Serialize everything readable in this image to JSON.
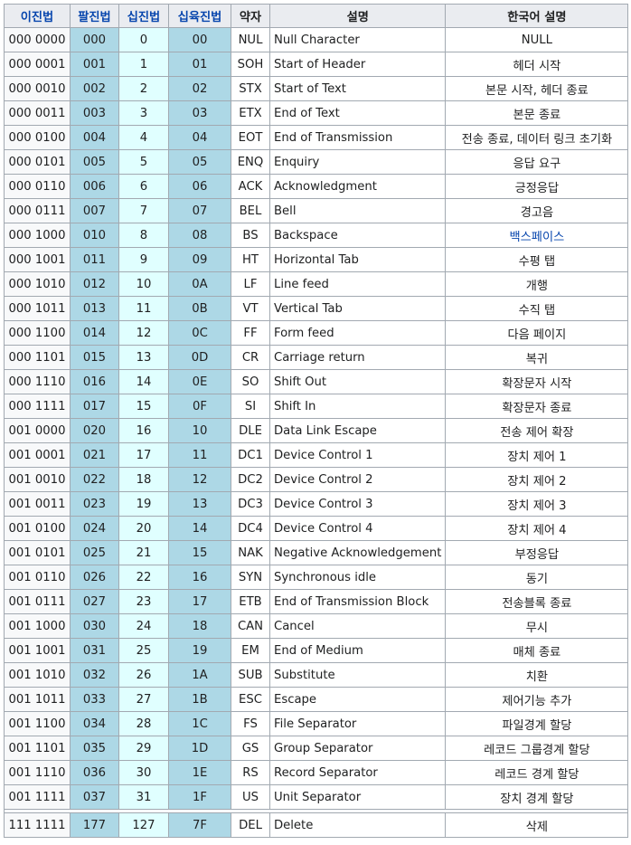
{
  "headers": {
    "bin": "이진법",
    "oct": "팔진법",
    "dec": "십진법",
    "hex": "십육진법",
    "abbr": "약자",
    "desc": "설명",
    "kor": "한국어 설명"
  },
  "rows": [
    {
      "bin": "000 0000",
      "oct": "000",
      "dec": "0",
      "hex": "00",
      "abbr": "NUL",
      "desc": "Null Character",
      "kor": "NULL"
    },
    {
      "bin": "000 0001",
      "oct": "001",
      "dec": "1",
      "hex": "01",
      "abbr": "SOH",
      "desc": "Start of Header",
      "kor": "헤더 시작"
    },
    {
      "bin": "000 0010",
      "oct": "002",
      "dec": "2",
      "hex": "02",
      "abbr": "STX",
      "desc": "Start of Text",
      "kor": "본문 시작, 헤더 종료"
    },
    {
      "bin": "000 0011",
      "oct": "003",
      "dec": "3",
      "hex": "03",
      "abbr": "ETX",
      "desc": "End of Text",
      "kor": "본문 종료"
    },
    {
      "bin": "000 0100",
      "oct": "004",
      "dec": "4",
      "hex": "04",
      "abbr": "EOT",
      "desc": "End of Transmission",
      "kor": "전송 종료, 데이터 링크 초기화"
    },
    {
      "bin": "000 0101",
      "oct": "005",
      "dec": "5",
      "hex": "05",
      "abbr": "ENQ",
      "desc": "Enquiry",
      "kor": "응답 요구"
    },
    {
      "bin": "000 0110",
      "oct": "006",
      "dec": "6",
      "hex": "06",
      "abbr": "ACK",
      "desc": "Acknowledgment",
      "kor": "긍정응답"
    },
    {
      "bin": "000 0111",
      "oct": "007",
      "dec": "7",
      "hex": "07",
      "abbr": "BEL",
      "desc": "Bell",
      "kor": "경고음"
    },
    {
      "bin": "000 1000",
      "oct": "010",
      "dec": "8",
      "hex": "08",
      "abbr": "BS",
      "desc": "Backspace",
      "kor": "백스페이스",
      "link": true
    },
    {
      "bin": "000 1001",
      "oct": "011",
      "dec": "9",
      "hex": "09",
      "abbr": "HT",
      "desc": "Horizontal Tab",
      "kor": "수평 탭"
    },
    {
      "bin": "000 1010",
      "oct": "012",
      "dec": "10",
      "hex": "0A",
      "abbr": "LF",
      "desc": "Line feed",
      "kor": "개행"
    },
    {
      "bin": "000 1011",
      "oct": "013",
      "dec": "11",
      "hex": "0B",
      "abbr": "VT",
      "desc": "Vertical Tab",
      "kor": "수직 탭"
    },
    {
      "bin": "000 1100",
      "oct": "014",
      "dec": "12",
      "hex": "0C",
      "abbr": "FF",
      "desc": "Form feed",
      "kor": "다음 페이지"
    },
    {
      "bin": "000 1101",
      "oct": "015",
      "dec": "13",
      "hex": "0D",
      "abbr": "CR",
      "desc": "Carriage return",
      "kor": "복귀"
    },
    {
      "bin": "000 1110",
      "oct": "016",
      "dec": "14",
      "hex": "0E",
      "abbr": "SO",
      "desc": "Shift Out",
      "kor": "확장문자 시작"
    },
    {
      "bin": "000 1111",
      "oct": "017",
      "dec": "15",
      "hex": "0F",
      "abbr": "SI",
      "desc": "Shift In",
      "kor": "확장문자 종료"
    },
    {
      "bin": "001 0000",
      "oct": "020",
      "dec": "16",
      "hex": "10",
      "abbr": "DLE",
      "desc": "Data Link Escape",
      "kor": "전송 제어 확장"
    },
    {
      "bin": "001 0001",
      "oct": "021",
      "dec": "17",
      "hex": "11",
      "abbr": "DC1",
      "desc": "Device Control 1",
      "kor": "장치 제어 1"
    },
    {
      "bin": "001 0010",
      "oct": "022",
      "dec": "18",
      "hex": "12",
      "abbr": "DC2",
      "desc": "Device Control 2",
      "kor": "장치 제어 2"
    },
    {
      "bin": "001 0011",
      "oct": "023",
      "dec": "19",
      "hex": "13",
      "abbr": "DC3",
      "desc": "Device Control 3",
      "kor": "장치 제어 3"
    },
    {
      "bin": "001 0100",
      "oct": "024",
      "dec": "20",
      "hex": "14",
      "abbr": "DC4",
      "desc": "Device Control 4",
      "kor": "장치 제어 4"
    },
    {
      "bin": "001 0101",
      "oct": "025",
      "dec": "21",
      "hex": "15",
      "abbr": "NAK",
      "desc": "Negative Acknowledgement",
      "kor": "부정응답"
    },
    {
      "bin": "001 0110",
      "oct": "026",
      "dec": "22",
      "hex": "16",
      "abbr": "SYN",
      "desc": "Synchronous idle",
      "kor": "동기"
    },
    {
      "bin": "001 0111",
      "oct": "027",
      "dec": "23",
      "hex": "17",
      "abbr": "ETB",
      "desc": "End of Transmission Block",
      "kor": "전송블록 종료"
    },
    {
      "bin": "001 1000",
      "oct": "030",
      "dec": "24",
      "hex": "18",
      "abbr": "CAN",
      "desc": "Cancel",
      "kor": "무시"
    },
    {
      "bin": "001 1001",
      "oct": "031",
      "dec": "25",
      "hex": "19",
      "abbr": "EM",
      "desc": "End of Medium",
      "kor": "매체 종료"
    },
    {
      "bin": "001 1010",
      "oct": "032",
      "dec": "26",
      "hex": "1A",
      "abbr": "SUB",
      "desc": "Substitute",
      "kor": "치환"
    },
    {
      "bin": "001 1011",
      "oct": "033",
      "dec": "27",
      "hex": "1B",
      "abbr": "ESC",
      "desc": "Escape",
      "kor": "제어기능 추가"
    },
    {
      "bin": "001 1100",
      "oct": "034",
      "dec": "28",
      "hex": "1C",
      "abbr": "FS",
      "desc": "File Separator",
      "kor": "파일경계 할당"
    },
    {
      "bin": "001 1101",
      "oct": "035",
      "dec": "29",
      "hex": "1D",
      "abbr": "GS",
      "desc": "Group Separator",
      "kor": "레코드 그룹경계 할당"
    },
    {
      "bin": "001 1110",
      "oct": "036",
      "dec": "30",
      "hex": "1E",
      "abbr": "RS",
      "desc": "Record Separator",
      "kor": "레코드 경계 할당"
    },
    {
      "bin": "001 1111",
      "oct": "037",
      "dec": "31",
      "hex": "1F",
      "abbr": "US",
      "desc": "Unit Separator",
      "kor": "장치 경계 할당"
    }
  ],
  "del_row": {
    "bin": "111 1111",
    "oct": "177",
    "dec": "127",
    "hex": "7F",
    "abbr": "DEL",
    "desc": "Delete",
    "kor": "삭제"
  },
  "colors": {
    "header_bg": "#eaecf0",
    "link": "#0645ad",
    "oct_bg": "#add8e6",
    "dec_bg": "#e0ffff",
    "hex_bg": "#add8e6",
    "border": "#a2a9b1"
  }
}
